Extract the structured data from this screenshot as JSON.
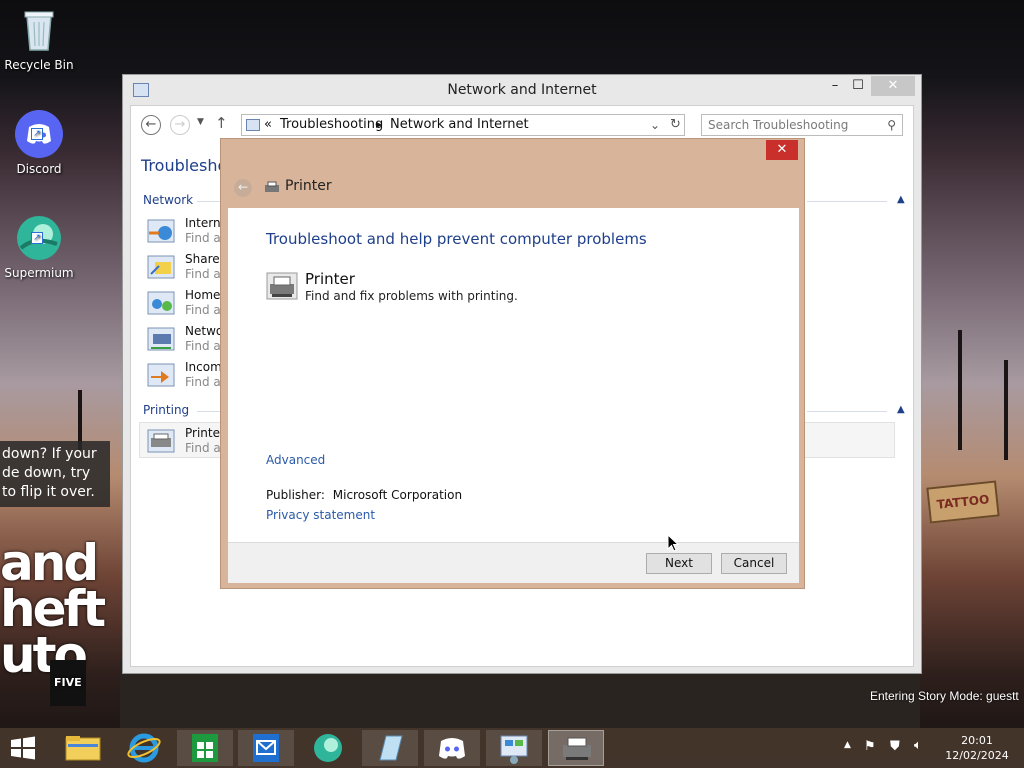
{
  "desktop": {
    "icons": [
      {
        "label": "Recycle Bin"
      },
      {
        "label": "Discord"
      },
      {
        "label": "Supermium"
      }
    ],
    "hint_text": "down? If your de down, try to flip it over.",
    "logo_lines": [
      "and",
      "heft",
      "uto"
    ],
    "logo_badge": "FIVE",
    "story_text": "Entering Story Mode: guestt",
    "sign_text": "TATTOO"
  },
  "window": {
    "title": "Network and Internet",
    "minimize": "–",
    "maximize": "☐",
    "close": "✕",
    "address": {
      "prefix": "«",
      "crumbs": [
        "Troubleshooting",
        "Network and Internet"
      ]
    },
    "search_placeholder": "Search Troubleshooting",
    "heading": "Troubleshoo",
    "sections": [
      {
        "label": "Network",
        "items": [
          {
            "title": "Interne",
            "desc": "Find ar"
          },
          {
            "title": "Shared",
            "desc": "Find ar"
          },
          {
            "title": "HomeG",
            "desc": "Find ar"
          },
          {
            "title": "Netwo",
            "desc": "Find ar"
          },
          {
            "title": "Incomi",
            "desc": "Find ar"
          }
        ]
      },
      {
        "label": "Printing",
        "items": [
          {
            "title": "Printer",
            "desc": "Find ar"
          }
        ]
      }
    ]
  },
  "dialog": {
    "close": "✕",
    "title": "Printer",
    "heading": "Troubleshoot and help prevent computer problems",
    "item_name": "Printer",
    "item_desc": "Find and fix problems with printing.",
    "advanced": "Advanced",
    "publisher_label": "Publisher:",
    "publisher_value": "Microsoft Corporation",
    "privacy": "Privacy statement",
    "next": "Next",
    "cancel": "Cancel"
  },
  "taskbar": {
    "time": "20:01",
    "date": "12/02/2024",
    "accent": "#4a3a30"
  }
}
